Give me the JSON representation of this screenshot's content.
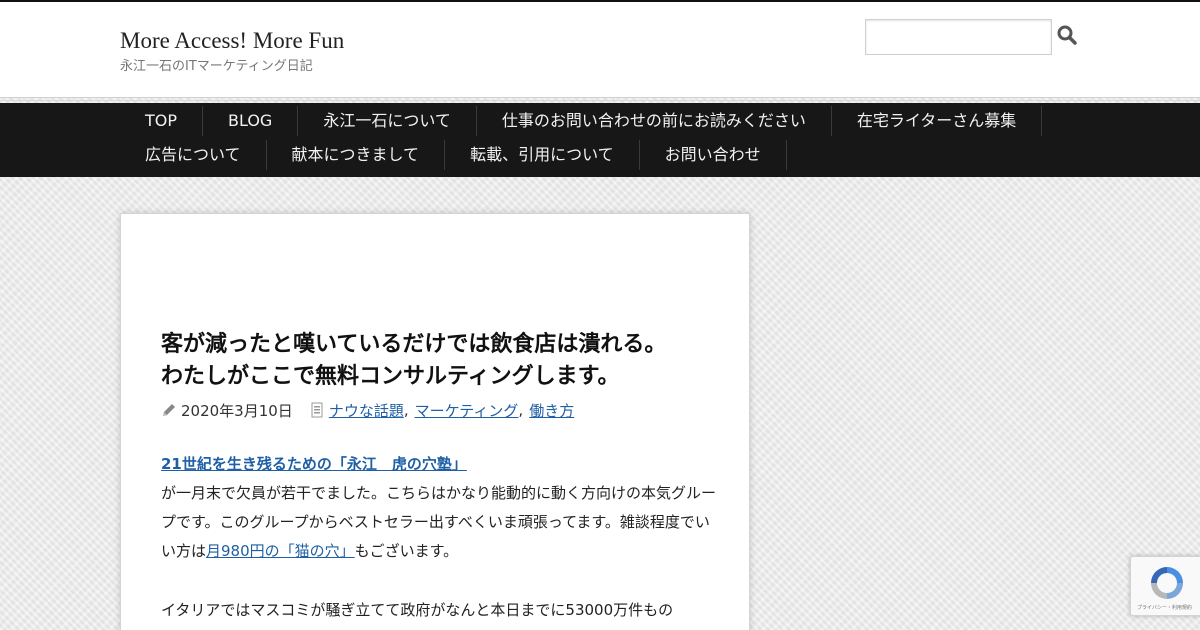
{
  "header": {
    "site_title": "More Access! More Fun",
    "tagline": "永江一石のITマーケティング日記",
    "search_placeholder": ""
  },
  "nav": {
    "row1": [
      "TOP",
      "BLOG",
      "永江一石について",
      "仕事のお問い合わせの前にお読みください",
      "在宅ライターさん募集"
    ],
    "row2": [
      "広告について",
      "献本につきまして",
      "転載、引用について",
      "お問い合わせ"
    ]
  },
  "post": {
    "title_line1": "客が減ったと嘆いているだけでは飲食店は潰れる。",
    "title_line2": "わたしがここで無料コンサルティングします。",
    "date": "2020年3月10日",
    "categories": [
      "ナウな話題",
      "マーケティング",
      "働き方"
    ],
    "intro_link": "21世紀を生き残るための「永江　虎の穴塾」",
    "intro_text": "が一月末で欠員が若干でました。こちらはかなり能動的に動く方向けの本気グループです。このグループからベストセラー出すべくいま頑張ってます。雑談程度でいい方は",
    "cat_link": "月980円の「猫の穴」",
    "intro_tail": "もございます。",
    "para2": "イタリアではマスコミが騒ぎ立てて政府がなんと本日までに53000万件もの"
  },
  "recaptcha": {
    "label": "プライバシー・利用規約"
  },
  "colors": {
    "nav_bg": "#171717",
    "link": "#1f5fa6",
    "page_bg": "#ececec"
  }
}
